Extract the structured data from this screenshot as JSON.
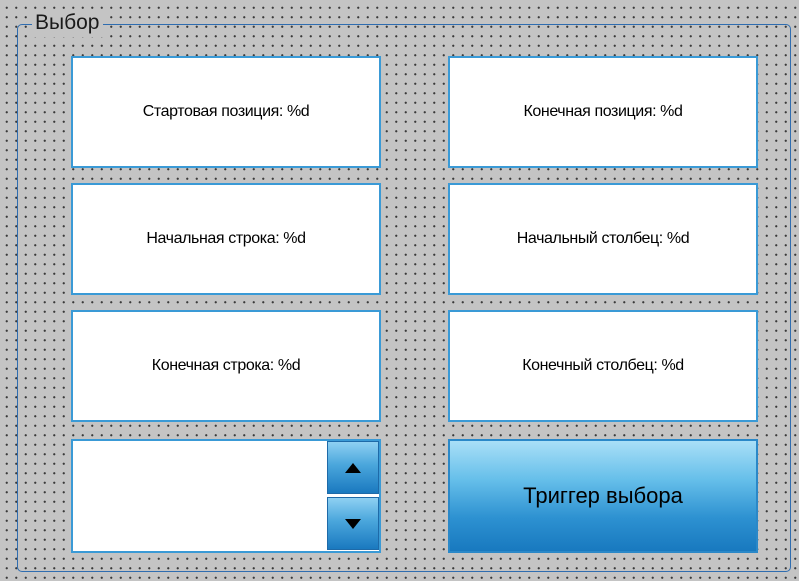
{
  "group": {
    "title": "Выбор"
  },
  "fields": {
    "start_position": "Стартовая позиция: %d",
    "end_position": "Конечная позиция: %d",
    "start_row": "Начальная строка: %d",
    "start_column": "Начальный столбец: %d",
    "end_row": "Конечная строка: %d",
    "end_column": "Конечный столбец: %d"
  },
  "spinner": {
    "value": "",
    "up_icon": "triangle-up-icon",
    "down_icon": "triangle-down-icon"
  },
  "trigger": {
    "label": "Триггер выбора"
  },
  "colors": {
    "background": "#c4c4c4",
    "border_accent": "#3a9ad6",
    "button_gradient_top": "#a9dff7",
    "button_gradient_bottom": "#1879bf"
  }
}
